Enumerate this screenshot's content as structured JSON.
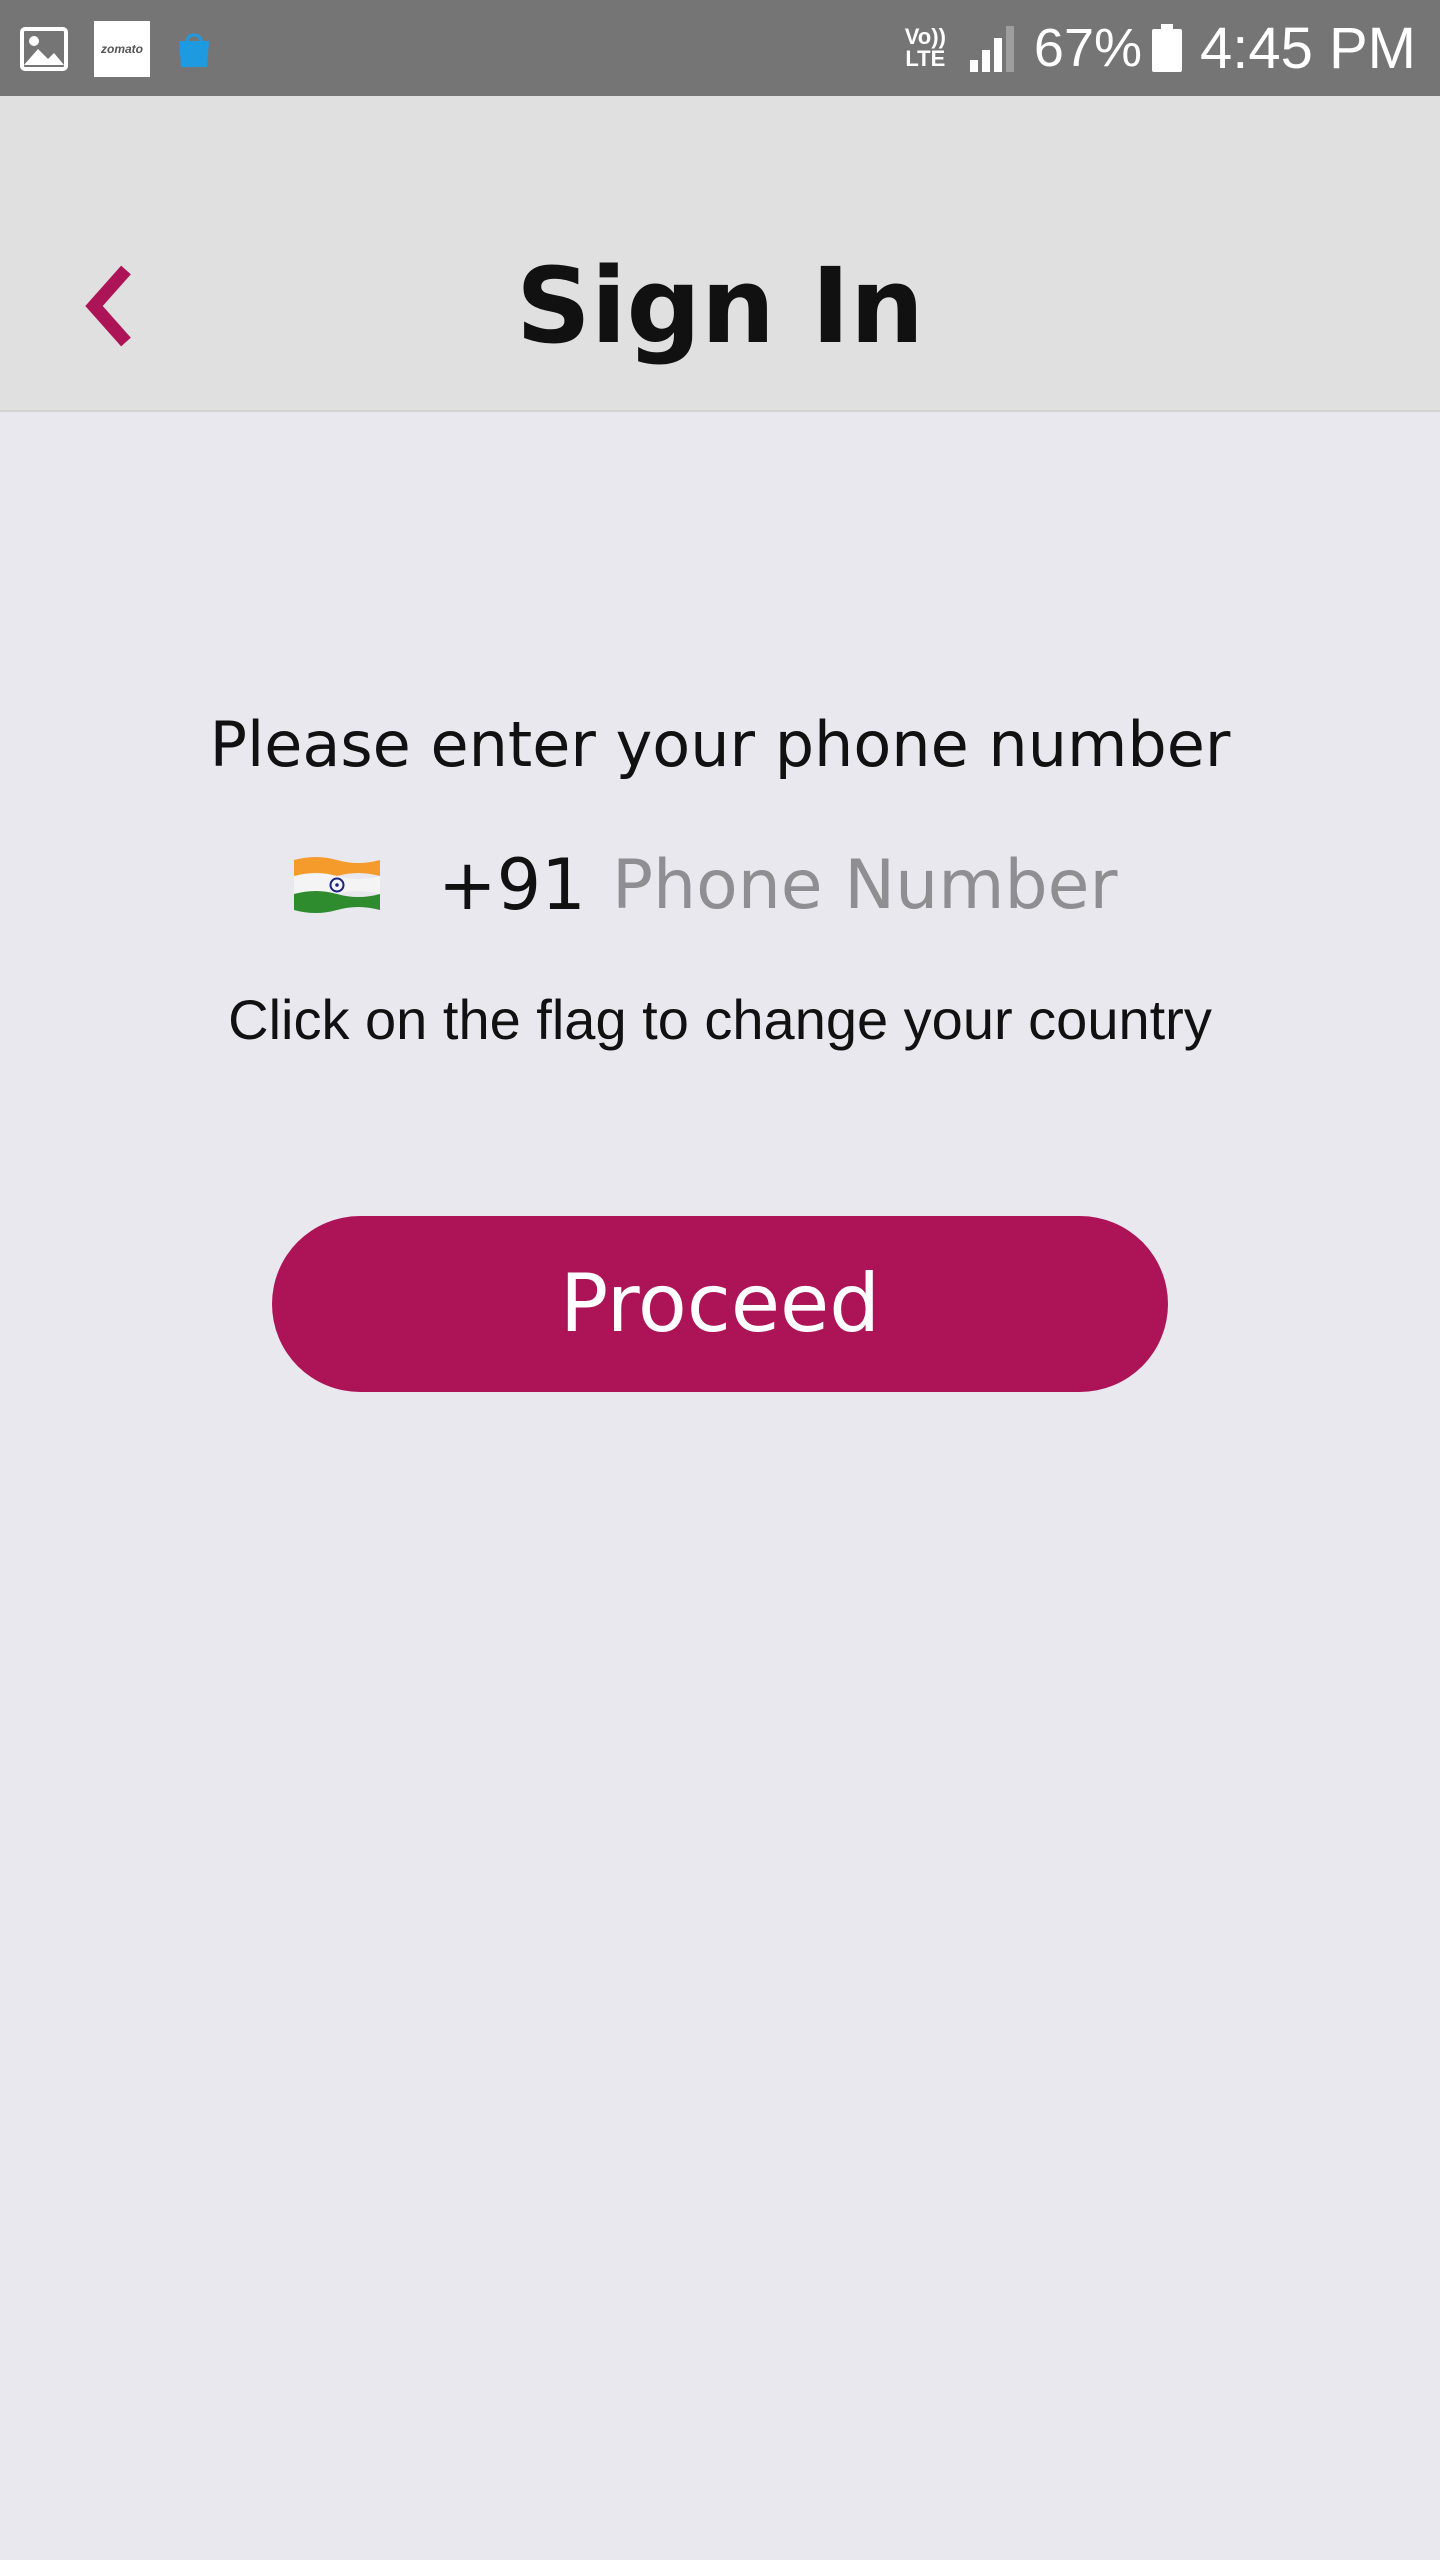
{
  "status_bar": {
    "notification_icons": [
      "gallery-icon",
      "zomato-app-icon",
      "shopping-bag-icon"
    ],
    "zomato_label": "zomato",
    "network_label_top": "Vo))",
    "network_label_bottom": "LTE",
    "battery_percent": "67%",
    "time": "4:45 PM"
  },
  "header": {
    "title": "Sign In",
    "back_icon": "chevron-left-icon"
  },
  "form": {
    "prompt": "Please enter your phone number",
    "country_flag": "india-flag",
    "country_code": "+91",
    "phone_placeholder": "Phone Number",
    "phone_value": "",
    "hint": "Click on the flag to change your country",
    "proceed_label": "Proceed"
  },
  "colors": {
    "accent": "#ad1457",
    "header_bg": "#e0e0e0",
    "page_bg": "#e9e8ef",
    "status_bar_bg": "#757575",
    "placeholder": "#8e8e93"
  }
}
